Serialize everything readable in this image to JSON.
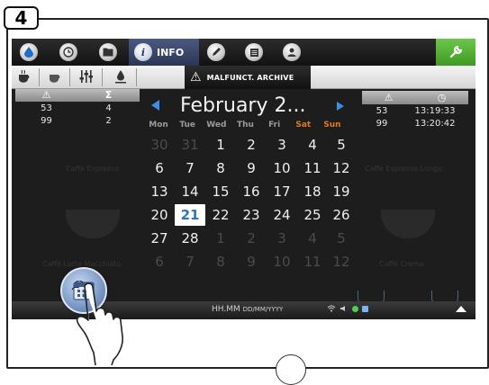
{
  "step": {
    "number": "4"
  },
  "topbar": {
    "tabs": [
      {
        "name": "water-drop-icon",
        "glyph": "💧"
      },
      {
        "name": "clock-icon",
        "glyph": "◷"
      },
      {
        "name": "folder-icon",
        "glyph": "▬"
      }
    ],
    "info_tab": {
      "label": "INFO",
      "glyph": "i"
    },
    "tabs_right": [
      {
        "name": "pencil-icon",
        "glyph": "✎"
      },
      {
        "name": "document-icon",
        "glyph": "▤"
      },
      {
        "name": "user-icon",
        "glyph": "♟"
      }
    ],
    "wrench_glyph": "🔧"
  },
  "subbar": {
    "archive_label": "MALFUNCT. ARCHIVE",
    "warning_glyph": "⚠"
  },
  "left_panel": {
    "headers": [
      "⚠",
      "Σ"
    ],
    "rows": [
      [
        "53",
        "4"
      ],
      [
        "99",
        "2"
      ]
    ]
  },
  "right_panel": {
    "headers": [
      "⚠",
      "◷"
    ],
    "rows": [
      [
        "53",
        "13:19:33"
      ],
      [
        "99",
        "13:20:42"
      ]
    ]
  },
  "calendar": {
    "month_title": "February 2...",
    "weekdays": [
      "Mon",
      "Tue",
      "Wed",
      "Thu",
      "Fri",
      "Sat",
      "Sun"
    ],
    "weekend_color": "#e07a1a",
    "selected_day": "21",
    "weeks": [
      [
        {
          "d": "30",
          "dim": true
        },
        {
          "d": "31",
          "dim": true
        },
        {
          "d": "1"
        },
        {
          "d": "2"
        },
        {
          "d": "3"
        },
        {
          "d": "4"
        },
        {
          "d": "5"
        }
      ],
      [
        {
          "d": "6"
        },
        {
          "d": "7"
        },
        {
          "d": "8"
        },
        {
          "d": "9"
        },
        {
          "d": "10"
        },
        {
          "d": "11"
        },
        {
          "d": "12"
        }
      ],
      [
        {
          "d": "13"
        },
        {
          "d": "14"
        },
        {
          "d": "15"
        },
        {
          "d": "16"
        },
        {
          "d": "17"
        },
        {
          "d": "18"
        },
        {
          "d": "19"
        }
      ],
      [
        {
          "d": "20"
        },
        {
          "d": "21",
          "today": true
        },
        {
          "d": "22"
        },
        {
          "d": "23"
        },
        {
          "d": "24"
        },
        {
          "d": "25"
        },
        {
          "d": "26"
        }
      ],
      [
        {
          "d": "27"
        },
        {
          "d": "28"
        },
        {
          "d": "1",
          "dim": true
        },
        {
          "d": "2",
          "dim": true
        },
        {
          "d": "3",
          "dim": true
        },
        {
          "d": "4",
          "dim": true
        },
        {
          "d": "5",
          "dim": true
        }
      ],
      [
        {
          "d": "6",
          "dim": true
        },
        {
          "d": "7",
          "dim": true
        },
        {
          "d": "8",
          "dim": true
        },
        {
          "d": "9",
          "dim": true
        },
        {
          "d": "10",
          "dim": true
        },
        {
          "d": "11",
          "dim": true
        },
        {
          "d": "12",
          "dim": true
        }
      ]
    ]
  },
  "statusbar": {
    "time_main": "HH.MM",
    "time_sub": "DD/MM/YYYY"
  },
  "background_labels": [
    "Caffè Espresso",
    "Caffè Espresso Lungo",
    "Caffè Latte Macchiato",
    "Caffè Crema"
  ],
  "colors": {
    "accent_blue": "#3a8fe6",
    "wrench_green": "#5bb33a",
    "today_text": "#2b73c4"
  }
}
